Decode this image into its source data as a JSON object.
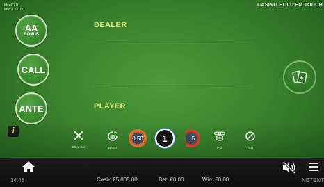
{
  "header": {
    "limits_min": "Min €0.10",
    "limits_max": "Max €100.00",
    "game_title": "CASINO HOLD'EM TOUCH"
  },
  "bet_buttons": {
    "bonus_main": "AA",
    "bonus_sub": "BONUS",
    "call": "CALL",
    "ante": "ANTE"
  },
  "table": {
    "dealer_label": "DEALER",
    "player_label": "PLAYER"
  },
  "controls": {
    "clear_bet": "Clear Bet",
    "rebet": "Rebet",
    "call": "Call",
    "fold": "Fold"
  },
  "chips": [
    {
      "value": "0.50",
      "color": "#d25a1e"
    },
    {
      "value": "1",
      "color": "#1a1a1a",
      "selected": true
    },
    {
      "value": "5",
      "color": "#b53020"
    }
  ],
  "footer": {
    "clock": "14:48",
    "cash": "Cash: €5,005.00",
    "bet": "Bet: €0.00",
    "win": "Win: €0.00",
    "brand": "NETENT"
  },
  "icons": [
    "home-icon",
    "mute-icon",
    "menu-icon",
    "info-icon",
    "cards-icon",
    "clear-bet-icon",
    "rebet-icon",
    "call-chips-icon",
    "fold-icon"
  ]
}
